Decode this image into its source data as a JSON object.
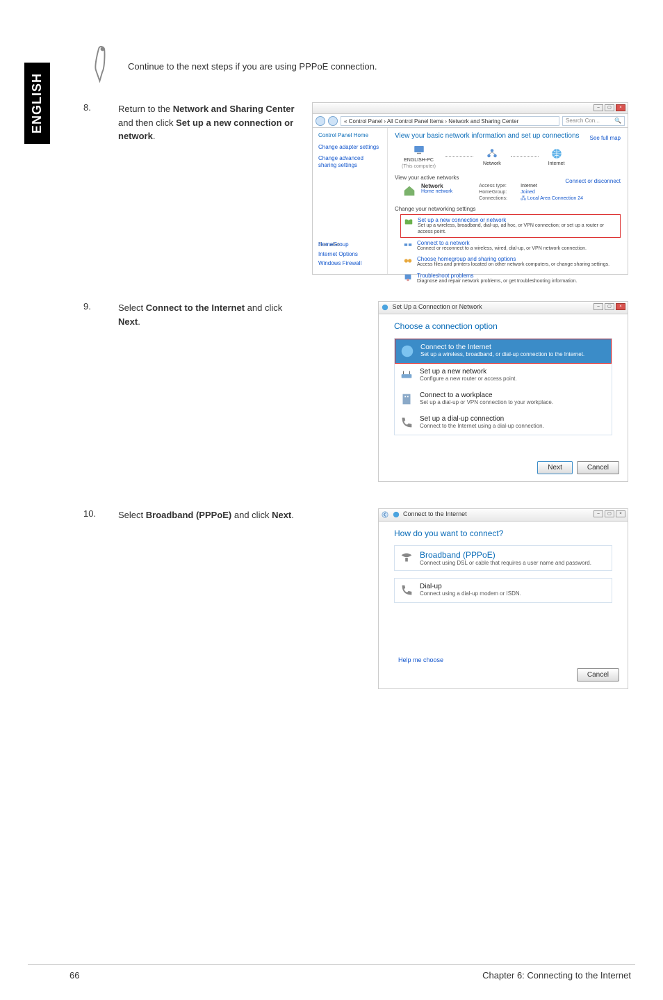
{
  "lang_tab": "ENGLISH",
  "note": "Continue to the next steps if you are using PPPoE connection.",
  "steps": {
    "s8": {
      "num": "8.",
      "text_parts": [
        "Return to the ",
        "Network and Sharing Center",
        " and then click ",
        "Set up a new connection or network",
        "."
      ]
    },
    "s9": {
      "num": "9.",
      "text_parts": [
        "Select ",
        "Connect to the Internet",
        " and click ",
        "Next",
        "."
      ]
    },
    "s10": {
      "num": "10.",
      "text_parts": [
        "Select ",
        "Broadband (PPPoE)",
        " and click ",
        "Next",
        "."
      ]
    }
  },
  "ncs": {
    "breadcrumb": "Control Panel  ›  All Control Panel Items  ›  Network and Sharing Center",
    "search_placeholder": "Search Con...",
    "side_home": "Control Panel Home",
    "side_adapter": "Change adapter settings",
    "side_advanced": "Change advanced sharing settings",
    "heading": "View your basic network information and set up connections",
    "see_full_map": "See full map",
    "node_pc": "ENGLISH-PC",
    "node_pc_sub": "(This computer)",
    "node_net": "Network",
    "node_inet": "Internet",
    "view_active": "View your active networks",
    "connect_or_disconnect": "Connect or disconnect",
    "active_name": "Network",
    "active_type": "Home network",
    "prop_access": "Access type:",
    "prop_access_v": "Internet",
    "prop_home": "HomeGroup:",
    "prop_home_v": "Joined",
    "prop_conn": "Connections:",
    "prop_conn_v": "Local Area Connection 24",
    "change_settings": "Change your networking settings",
    "t1_t": "Set up a new connection or network",
    "t1_d": "Set up a wireless, broadband, dial-up, ad hoc, or VPN connection; or set up a router or access point.",
    "t2_t": "Connect to a network",
    "t2_d": "Connect or reconnect to a wireless, wired, dial-up, or VPN network connection.",
    "t3_t": "Choose homegroup and sharing options",
    "t3_d": "Access files and printers located on other network computers, or change sharing settings.",
    "t4_t": "Troubleshoot problems",
    "t4_d": "Diagnose and repair network problems, or get troubleshooting information.",
    "see_also": "See also",
    "sa1": "HomeGroup",
    "sa2": "Internet Options",
    "sa3": "Windows Firewall"
  },
  "dlg2": {
    "title": "Set Up a Connection or Network",
    "heading": "Choose a connection option",
    "o1_t": "Connect to the Internet",
    "o1_d": "Set up a wireless, broadband, or dial-up connection to the Internet.",
    "o2_t": "Set up a new network",
    "o2_d": "Configure a new router or access point.",
    "o3_t": "Connect to a workplace",
    "o3_d": "Set up a dial-up or VPN connection to your workplace.",
    "o4_t": "Set up a dial-up connection",
    "o4_d": "Connect to the Internet using a dial-up connection.",
    "btn_next": "Next",
    "btn_cancel": "Cancel"
  },
  "dlg3": {
    "title": "Connect to the Internet",
    "heading": "How do you want to connect?",
    "o1_t": "Broadband (PPPoE)",
    "o1_d": "Connect using DSL or cable that requires a user name and password.",
    "o2_t": "Dial-up",
    "o2_d": "Connect using a dial-up modem or ISDN.",
    "help": "Help me choose",
    "btn_cancel": "Cancel"
  },
  "footer": {
    "page_num": "66",
    "chapter": "Chapter 6: Connecting to the Internet"
  }
}
